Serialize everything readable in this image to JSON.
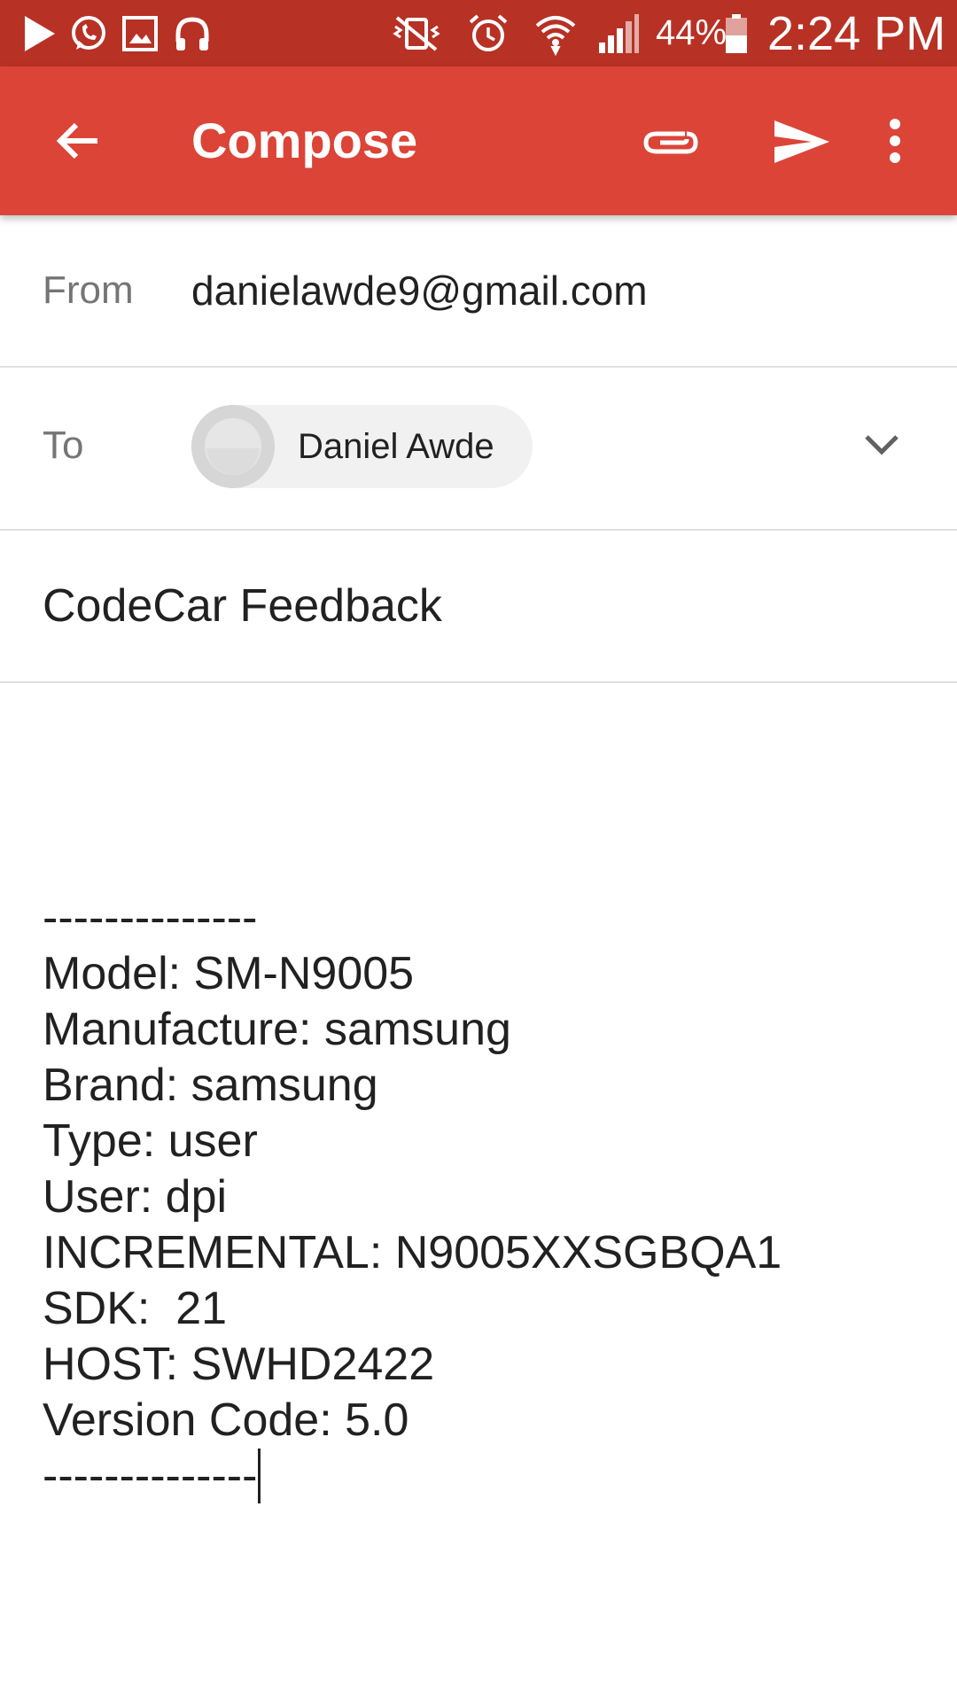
{
  "status_bar": {
    "icons_left": [
      "play-store-icon",
      "whatsapp-icon",
      "gallery-icon",
      "headset-icon"
    ],
    "icons_right": [
      "vibrate-mute-icon",
      "alarm-icon",
      "wifi-icon",
      "signal-icon"
    ],
    "battery": "44%",
    "time": "2:24 PM"
  },
  "app_bar": {
    "title": "Compose",
    "back_icon": "arrow-back-icon",
    "attach_icon": "paperclip-icon",
    "send_icon": "send-icon",
    "more_icon": "more-vert-icon",
    "color": "#db4437"
  },
  "from": {
    "label": "From",
    "value": "danielawde9@gmail.com"
  },
  "to": {
    "label": "To",
    "recipients": [
      {
        "name": "Daniel Awde"
      }
    ],
    "expand_icon": "chevron-down-icon"
  },
  "subject": {
    "value": "CodeCar Feedback"
  },
  "body": {
    "lines": [
      "--------------",
      "Model: SM-N9005",
      "Manufacture: samsung",
      "Brand: samsung",
      "Type: user",
      "User: dpi",
      "INCREMENTAL: N9005XXSGBQA1",
      "SDK:  21",
      "HOST: SWHD2422",
      "Version Code: 5.0",
      "--------------"
    ]
  }
}
